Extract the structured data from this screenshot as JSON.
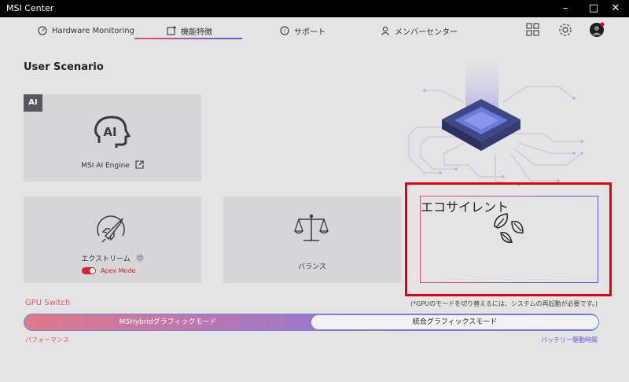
{
  "window": {
    "title": "MSI Center",
    "minimize": "–",
    "maximize": "□",
    "close": "✕"
  },
  "tabs": [
    {
      "label": "Hardware Monitoring",
      "icon": "gauge-icon"
    },
    {
      "label": "機能特徴",
      "icon": "feature-icon"
    },
    {
      "label": "サポート",
      "icon": "support-icon"
    },
    {
      "label": "メンバーセンター",
      "icon": "user-icon"
    }
  ],
  "section_title": "User Scenario",
  "ai_card": {
    "badge": "AI",
    "label": "MSI AI Engine"
  },
  "scenarios": [
    {
      "label": "エクストリーム",
      "icon": "rocket-icon"
    },
    {
      "label": "バランス",
      "icon": "scale-icon"
    },
    {
      "label": "エコサイレント",
      "icon": "leaves-icon"
    }
  ],
  "apex_mode": {
    "label": "Apex Mode",
    "on": true
  },
  "gpu_switch": {
    "title": "GPU Switch",
    "note": "(*GPUのモードを切り替えるには、システムの再起動が必要です。)",
    "left_option": "MSHybridグラフィックモード",
    "right_option": "統合グラフィックスモード",
    "left_caption": "パフォーマンス",
    "right_caption": "バッテリー駆動時間"
  },
  "colors": {
    "accent_red": "#e05565",
    "accent_blue": "#5a5ed8",
    "highlight": "#e6000c"
  }
}
